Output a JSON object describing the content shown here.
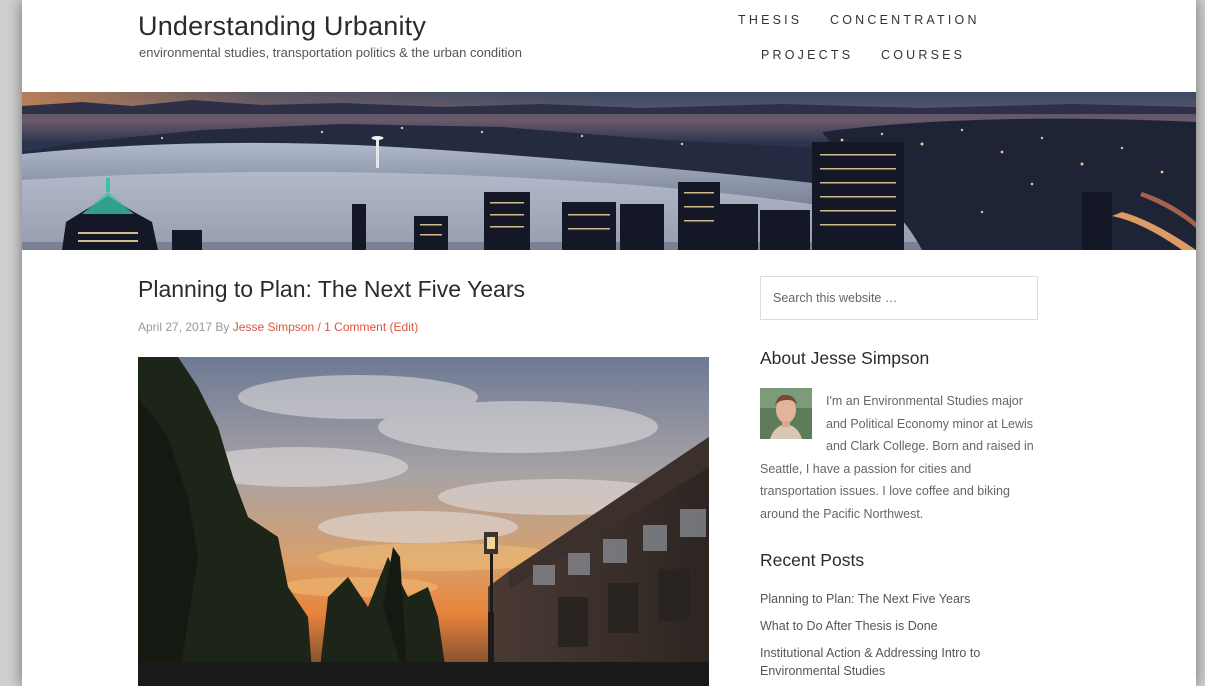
{
  "site": {
    "title": "Understanding Urbanity",
    "tagline": "environmental studies, transportation politics & the urban condition"
  },
  "nav": {
    "items": [
      "THESIS",
      "CONCENTRATION",
      "PROJECTS",
      "COURSES"
    ]
  },
  "post": {
    "title": "Planning to Plan: The Next Five Years",
    "date": "April 27, 2017",
    "by": "By",
    "author": "Jesse Simpson",
    "separator": "/",
    "comments": "1 Comment",
    "edit": "(Edit)"
  },
  "sidebar": {
    "search_placeholder": "Search this website …",
    "about": {
      "title": "About Jesse Simpson",
      "text": "I'm an Environmental Studies major and Political Economy minor at Lewis and Clark College. Born and raised in Seattle, I have a passion for cities and transportation issues. I love coffee and biking around the Pacific Northwest."
    },
    "recent": {
      "title": "Recent Posts",
      "items": [
        "Planning to Plan: The Next Five Years",
        "What to Do After Thesis is Done",
        "Institutional Action & Addressing Intro to Environmental Studies"
      ]
    }
  },
  "colors": {
    "link_accent": "#e0533f",
    "heading": "#2b2b2b",
    "body_text": "#666666"
  }
}
